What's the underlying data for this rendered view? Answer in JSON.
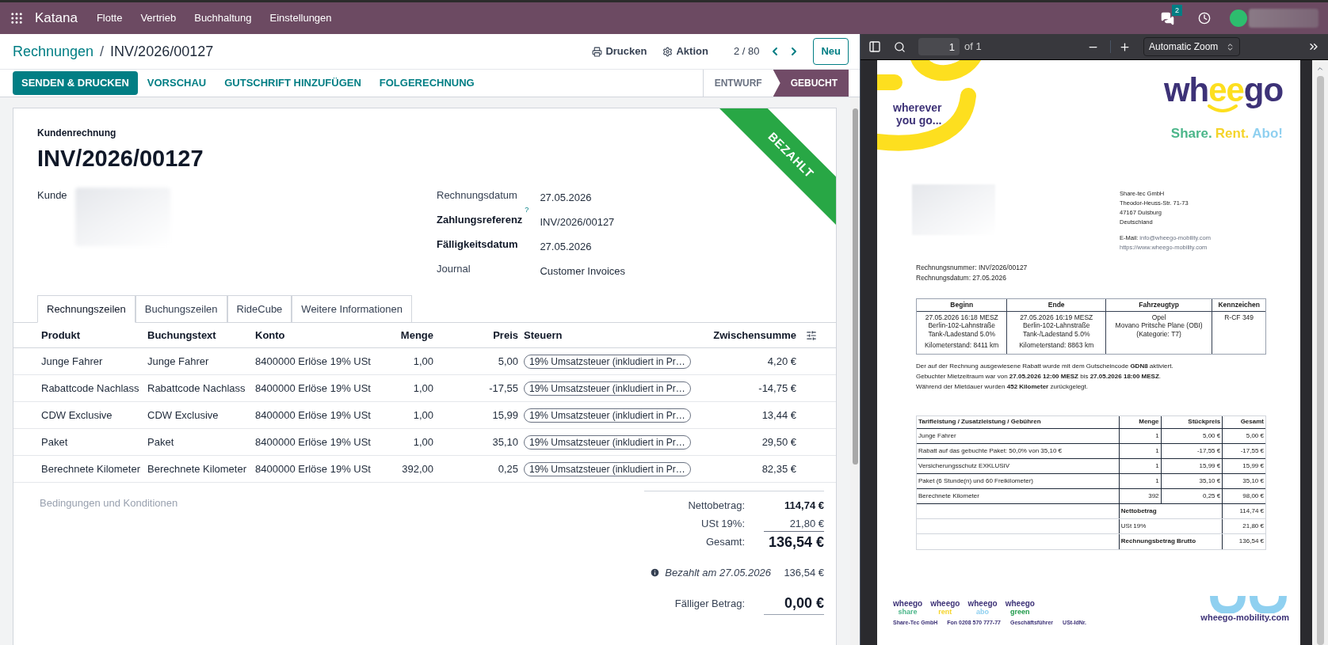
{
  "navbar": {
    "app": "Katana",
    "menu": [
      "Flotte",
      "Vertrieb",
      "Buchhaltung",
      "Einstellungen"
    ],
    "messages_badge": "2"
  },
  "breadcrumb": {
    "parent": "Rechnungen",
    "separator": "/",
    "current": "INV/2026/00127"
  },
  "actions": {
    "print": "Drucken",
    "action": "Aktion",
    "pager": "2 / 80",
    "new": "Neu"
  },
  "buttons": [
    {
      "label": "SENDEN & DRUCKEN",
      "primary": true
    },
    {
      "label": "VORSCHAU",
      "primary": false
    },
    {
      "label": "GUTSCHRIFT HINZUFÜGEN",
      "primary": false
    },
    {
      "label": "FOLGERECHNUNG",
      "primary": false
    }
  ],
  "status": [
    {
      "label": "ENTWURF",
      "selected": false
    },
    {
      "label": "GEBUCHT",
      "selected": true
    }
  ],
  "ribbon": "BEZAHLT",
  "form": {
    "type_label": "Kundenrechnung",
    "number": "INV/2026/00127",
    "customer_label": "Kunde",
    "fields": [
      {
        "label": "Rechnungsdatum",
        "value": "27.05.2026",
        "bold": false
      },
      {
        "label": "Zahlungsreferenz",
        "help": "?",
        "value": "INV/2026/00127",
        "bold": true
      },
      {
        "label": "Fälligkeitsdatum",
        "value": "27.05.2026",
        "bold": true
      },
      {
        "label": "Journal",
        "value": "Customer Invoices",
        "bold": false
      }
    ]
  },
  "tabs": [
    {
      "label": "Rechnungszeilen",
      "selected": true
    },
    {
      "label": "Buchungszeilen",
      "selected": false
    },
    {
      "label": "RideCube",
      "selected": false
    },
    {
      "label": "Weitere Informationen",
      "selected": false
    }
  ],
  "lines": {
    "columns": [
      "Produkt",
      "Buchungstext",
      "Konto",
      "Menge",
      "Preis",
      "Steuern",
      "Zwischensumme"
    ],
    "rows": [
      {
        "product": "Junge Fahrer",
        "label": "Junge Fahrer",
        "account": "8400000 Erlöse 19% USt",
        "qty": "1,00",
        "price": "5,00",
        "tax": "19% Umsatzsteuer (inkludiert in Pr…",
        "subtotal": "4,20 €"
      },
      {
        "product": "Rabattcode Nachlass",
        "label": "Rabattcode Nachlass",
        "account": "8400000 Erlöse 19% USt",
        "qty": "1,00",
        "price": "-17,55",
        "tax": "19% Umsatzsteuer (inkludiert in Pr…",
        "subtotal": "-14,75 €"
      },
      {
        "product": "CDW Exclusive",
        "label": "CDW Exclusive",
        "account": "8400000 Erlöse 19% USt",
        "qty": "1,00",
        "price": "15,99",
        "tax": "19% Umsatzsteuer (inkludiert in Pr…",
        "subtotal": "13,44 €"
      },
      {
        "product": "Paket",
        "label": "Paket",
        "account": "8400000 Erlöse 19% USt",
        "qty": "1,00",
        "price": "35,10",
        "tax": "19% Umsatzsteuer (inkludiert in Pr…",
        "subtotal": "29,50 €"
      },
      {
        "product": "Berechnete Kilometer",
        "label": "Berechnete Kilometer",
        "account": "8400000 Erlöse 19% USt",
        "qty": "392,00",
        "price": "0,25",
        "tax": "19% Umsatzsteuer (inkludiert in Pr…",
        "subtotal": "82,35 €"
      }
    ]
  },
  "terms_placeholder": "Bedingungen und Konditionen",
  "totals": [
    {
      "label": "Nettobetrag:",
      "value": "114,74 €",
      "kind": "subtotal"
    },
    {
      "label": "USt 19%:",
      "value": "21,80 €",
      "kind": "tax"
    },
    {
      "label": "Gesamt:",
      "value": "136,54 €",
      "kind": "total"
    }
  ],
  "payments": [
    {
      "label": "Bezahlt am 27.05.2026",
      "value": "136,54 €"
    }
  ],
  "due": {
    "label": "Fälliger Betrag:",
    "value": "0,00 €"
  },
  "viewer": {
    "page": "1",
    "page_count": "of 1",
    "zoom": "Automatic Zoom"
  },
  "pdf": {
    "slogan": [
      "wherever",
      "you go..."
    ],
    "logo": [
      "wh",
      "ee",
      "go"
    ],
    "tagline": [
      {
        "text": "Share.",
        "color": "#4bb68a"
      },
      {
        "text": "Rent.",
        "color": "#f5d42a"
      },
      {
        "text": "Abo!",
        "color": "#8fd0f0"
      }
    ],
    "company": [
      "Share-tec GmbH",
      "Theodor-Heuss-Str. 71-73",
      "47167 Duisburg",
      "Deutschland"
    ],
    "email_label": "E-Mail:",
    "email": "info@wheego-mobility.com",
    "website": "https://www.wheego-mobility.com",
    "info": [
      "Rechnungsnummer: INV/2026/00127",
      "Rechnungsdatum: 27.05.2026"
    ],
    "trip_columns": [
      "Beginn",
      "Ende",
      "Fahrzeugtyp",
      "Kennzeichen"
    ],
    "trip_cells": [
      {
        "lines": [
          "27.05.2026 16:18 MESZ",
          "Berlin-102-Lahnstraße",
          "Tank-/Ladestand 5.0%"
        ],
        "km": "Kilometerstand: 8411 km"
      },
      {
        "lines": [
          "27.05.2026 16:19 MESZ",
          "Berlin-102-Lahnstraße",
          "Tank-/Ladestand 5.0%"
        ],
        "km": "Kilometerstand: 8863 km"
      },
      {
        "lines": [
          "Opel",
          "Movano Pritsche Plane (OBI)",
          "(Kategorie: T7)"
        ]
      },
      {
        "lines": [
          "R-CF 349"
        ]
      }
    ],
    "notes": [
      "Der auf der Rechnung ausgewiesene Rabatt wurde mit dem Gutscheincode **GDN8** aktiviert.",
      "Gebuchter Mietzeitraum war von **27.05.2026 12:00 MESZ** bis **27.05.2026 18:00 MESZ**.",
      "Während der Mietdauer wurden **452 Kilometer** zurückgelegt."
    ],
    "item_columns": [
      "Tarifleistung / Zusatzleistung / Gebühren",
      "Menge",
      "Stückpreis",
      "Gesamt"
    ],
    "items": [
      [
        "Junge Fahrer",
        "1",
        "5,00 €",
        "5,00 €"
      ],
      [
        "Rabatt auf das gebuchte Paket: 50,0% von 35,10 €",
        "1",
        "-17,55 €",
        "-17,55 €"
      ],
      [
        "Versicherungsschutz EXKLUSIV",
        "1",
        "15,99 €",
        "15,99 €"
      ],
      [
        "Paket (6 Stunde(n) und 60 Freikilometer)",
        "1",
        "35,10 €",
        "35,10 €"
      ],
      [
        "Berechnete Kilometer",
        "392",
        "0,25 €",
        "98,00 €"
      ]
    ],
    "sums": [
      {
        "label": "Nettobetrag",
        "value": "114,74 €",
        "bold": true
      },
      {
        "label": "USt 19%",
        "value": "21,80 €",
        "bold": false
      },
      {
        "label": "Rechnungsbetrag Brutto",
        "value": "136,54 €",
        "bold": true
      }
    ],
    "footer_brands": [
      {
        "name": "wheego",
        "sub": "share",
        "color": "#4bb68a"
      },
      {
        "name": "wheego",
        "sub": "rent",
        "color": "#f5d42a"
      },
      {
        "name": "wheego",
        "sub": "abo",
        "color": "#8fd0f0"
      },
      {
        "name": "wheego",
        "sub": "green",
        "color": "#1f9a4a"
      }
    ],
    "footer_info": [
      "Share-Tec GmbH",
      "Fon 0208 570 777-77",
      "Geschäftsführer",
      "USt-IdNr."
    ],
    "footer_site": "wheego-mobility.com"
  }
}
